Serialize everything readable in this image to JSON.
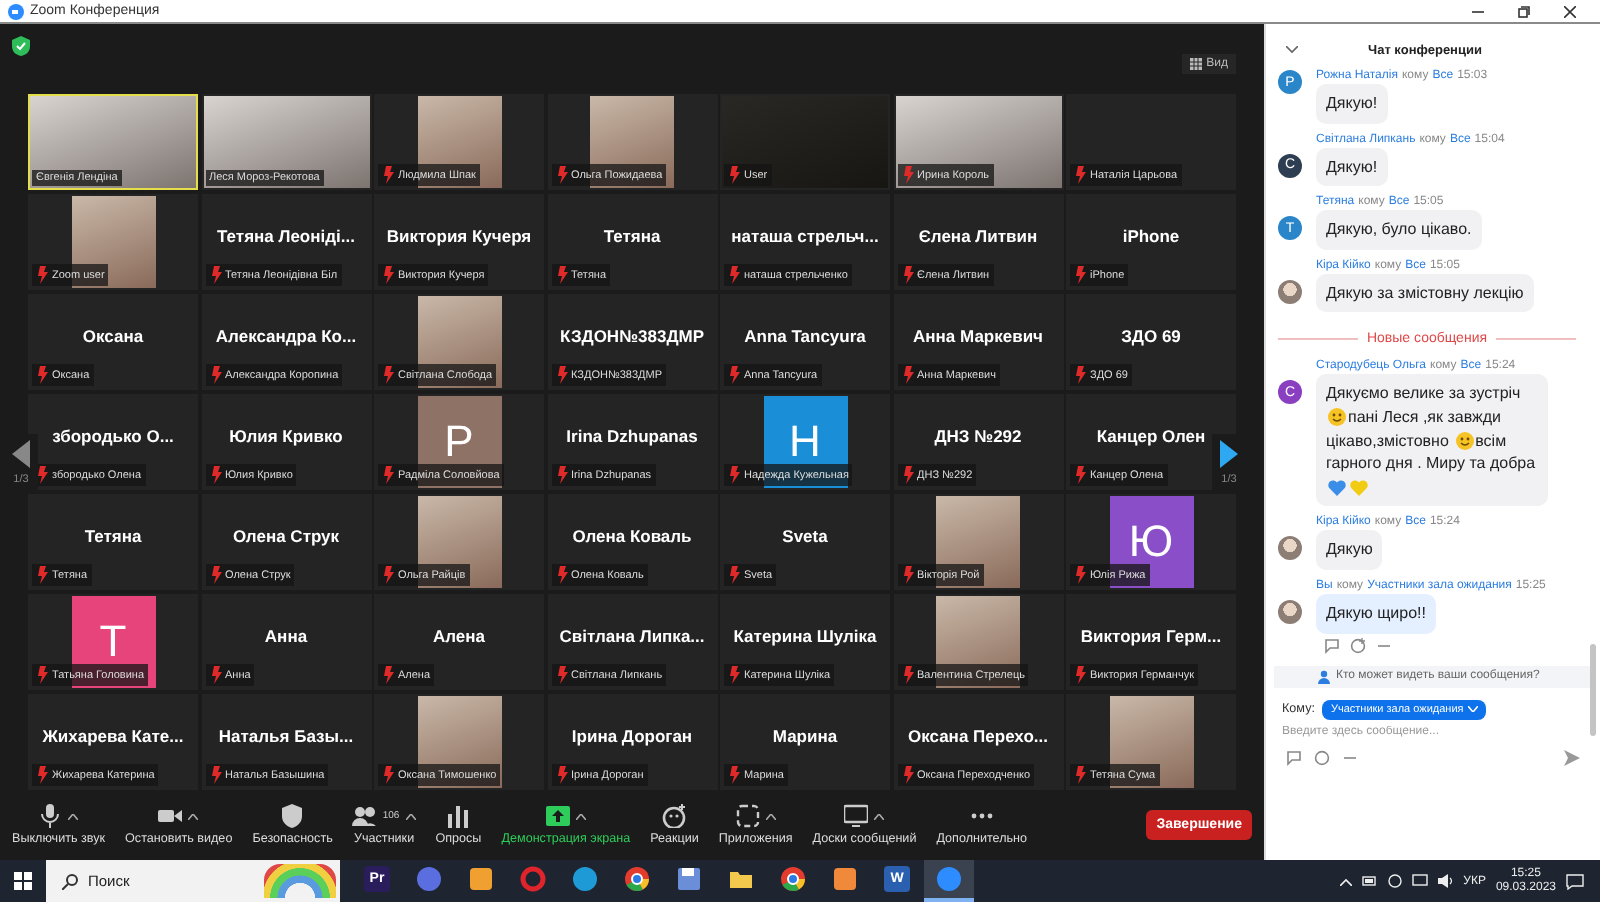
{
  "window": {
    "title": "Zoom Конференция"
  },
  "meeting": {
    "view_button": "Вид",
    "page_left": "1/3",
    "page_right": "1/3",
    "tiles": [
      {
        "kind": "video",
        "label": "Євгенія Лендіна",
        "muted": false,
        "speaking": true
      },
      {
        "kind": "video",
        "label": "Леся Мороз-Рекотова",
        "muted": false,
        "speaking": false
      },
      {
        "kind": "photo",
        "label": "Людмила Шпак",
        "muted": true,
        "speaking": false
      },
      {
        "kind": "photo",
        "label": "Ольга Пожидаева",
        "muted": true,
        "speaking": false
      },
      {
        "kind": "video",
        "label": "User",
        "muted": true,
        "speaking": false
      },
      {
        "kind": "video",
        "label": "Ирина Король",
        "muted": true,
        "speaking": false
      },
      {
        "kind": "blank",
        "label": "Наталія Царьова",
        "muted": true,
        "speaking": false
      },
      {
        "kind": "photo",
        "label": "Zoom user",
        "muted": true,
        "speaking": false
      },
      {
        "kind": "name",
        "name": "Тетяна Леонідi...",
        "label": "Тетяна Леонідівна Біл",
        "muted": true,
        "speaking": false
      },
      {
        "kind": "name",
        "name": "Виктория Кучеря",
        "label": "Виктория Кучеря",
        "muted": true,
        "speaking": false
      },
      {
        "kind": "name",
        "name": "Тетяна",
        "label": "Тетяна",
        "muted": true,
        "speaking": false
      },
      {
        "kind": "name",
        "name": "наташа стрельч...",
        "label": "наташа стрельченко",
        "muted": true,
        "speaking": false
      },
      {
        "kind": "name",
        "name": "Єлена Литвин",
        "label": "Єлена Литвин",
        "muted": true,
        "speaking": false
      },
      {
        "kind": "name",
        "name": "iPhone",
        "label": "iPhone",
        "muted": true,
        "speaking": false
      },
      {
        "kind": "name",
        "name": "Оксана",
        "label": "Оксана",
        "muted": true,
        "speaking": false
      },
      {
        "kind": "name",
        "name": "Александра Ко...",
        "label": "Александра Коропина",
        "muted": true,
        "speaking": false
      },
      {
        "kind": "photo",
        "label": "Світлана Слобода",
        "muted": true,
        "speaking": false
      },
      {
        "kind": "name",
        "name": "КЗДОН№383ДМР",
        "label": "КЗДОН№383ДМР",
        "muted": true,
        "speaking": false
      },
      {
        "kind": "name",
        "name": "Anna Tancyura",
        "label": "Anna Tancyura",
        "muted": true,
        "speaking": false
      },
      {
        "kind": "name",
        "name": "Анна Маркевич",
        "label": "Анна Маркевич",
        "muted": true,
        "speaking": false
      },
      {
        "kind": "name",
        "name": "ЗДО 69",
        "label": "ЗДО 69",
        "muted": true,
        "speaking": false
      },
      {
        "kind": "name",
        "name": "зборoдько О...",
        "label": "зборoдько Олена",
        "muted": true,
        "speaking": false
      },
      {
        "kind": "name",
        "name": "Юлия Кривко",
        "label": "Юлия Кривко",
        "muted": true,
        "speaking": false
      },
      {
        "kind": "avatar",
        "letter": "P",
        "color": "#8e7266",
        "label": "Радміла Соловйова",
        "muted": true,
        "speaking": false
      },
      {
        "kind": "name",
        "name": "Irina Dzhupanas",
        "label": "Irina Dzhupanas",
        "muted": true,
        "speaking": false
      },
      {
        "kind": "avatar",
        "letter": "H",
        "color": "#1a8fd8",
        "label": "Надежда Кужельная",
        "muted": true,
        "speaking": false
      },
      {
        "kind": "name",
        "name": "ДНЗ №292",
        "label": "ДНЗ №292",
        "muted": true,
        "speaking": false
      },
      {
        "kind": "name",
        "name": "Канцер Олен",
        "label": "Канцер Олена",
        "muted": true,
        "speaking": false
      },
      {
        "kind": "name",
        "name": "Тетяна",
        "label": "Тетяна",
        "muted": true,
        "speaking": false
      },
      {
        "kind": "name",
        "name": "Олена Струк",
        "label": "Олена Струк",
        "muted": true,
        "speaking": false
      },
      {
        "kind": "photo",
        "label": "Ольга Райців",
        "muted": true,
        "speaking": false
      },
      {
        "kind": "name",
        "name": "Олена Коваль",
        "label": "Олена Коваль",
        "muted": true,
        "speaking": false
      },
      {
        "kind": "name",
        "name": "Sveta",
        "label": "Sveta",
        "muted": true,
        "speaking": false
      },
      {
        "kind": "photo",
        "label": "Вікторія Рой",
        "muted": true,
        "speaking": false
      },
      {
        "kind": "avatar",
        "letter": "Ю",
        "color": "#8a4fc8",
        "label": "Юлія Рижа",
        "muted": true,
        "speaking": false
      },
      {
        "kind": "avatar",
        "letter": "T",
        "color": "#e6447b",
        "label": "Татьяна Головина",
        "muted": true,
        "speaking": false
      },
      {
        "kind": "name",
        "name": "Анна",
        "label": "Анна",
        "muted": true,
        "speaking": false
      },
      {
        "kind": "name",
        "name": "Алена",
        "label": "Алена",
        "muted": true,
        "speaking": false
      },
      {
        "kind": "name",
        "name": "Світлана Липка...",
        "label": "Світлана Липкань",
        "muted": true,
        "speaking": false
      },
      {
        "kind": "name",
        "name": "Катерина Шуліка",
        "label": "Катерина Шуліка",
        "muted": true,
        "speaking": false
      },
      {
        "kind": "photo",
        "label": "Валентина Стрелець",
        "muted": true,
        "speaking": false
      },
      {
        "kind": "name",
        "name": "Виктория Герм...",
        "label": "Виктория Германчук",
        "muted": true,
        "speaking": false
      },
      {
        "kind": "name",
        "name": "Жихарева Кате...",
        "label": "Жихарева Катерина",
        "muted": true,
        "speaking": false
      },
      {
        "kind": "name",
        "name": "Наталья Базы...",
        "label": "Наталья Базышина",
        "muted": true,
        "speaking": false
      },
      {
        "kind": "photo",
        "label": "Оксана Тимошенко",
        "muted": true,
        "speaking": false
      },
      {
        "kind": "name",
        "name": "Ірина Дороган",
        "label": "Ірина Дороган",
        "muted": true,
        "speaking": false
      },
      {
        "kind": "name",
        "name": "Марина",
        "label": "Марина",
        "muted": true,
        "speaking": false
      },
      {
        "kind": "name",
        "name": "Оксана Перехо...",
        "label": "Оксана Переходченко",
        "muted": true,
        "speaking": false
      },
      {
        "kind": "photo",
        "label": "Тетяна Сума",
        "muted": true,
        "speaking": false
      }
    ]
  },
  "toolbar": {
    "items": [
      {
        "kind": "mic",
        "label": "Выключить звук",
        "caret": true
      },
      {
        "kind": "video",
        "label": "Остановить видео",
        "caret": true
      },
      {
        "kind": "security",
        "label": "Безопасность",
        "caret": false
      },
      {
        "kind": "participants",
        "label": "Участники",
        "count": "106",
        "caret": true
      },
      {
        "kind": "polls",
        "label": "Опросы",
        "caret": false
      },
      {
        "kind": "share",
        "label": "Демонстрация экрана",
        "caret": true
      },
      {
        "kind": "reactions",
        "label": "Реакции",
        "caret": false
      },
      {
        "kind": "apps",
        "label": "Приложения",
        "caret": true
      },
      {
        "kind": "boards",
        "label": "Доски сообщений",
        "caret": true
      },
      {
        "kind": "more",
        "label": "Дополнительно",
        "caret": false
      }
    ],
    "end_button": "Завершение"
  },
  "chat": {
    "title": "Чат конференции",
    "messages": [
      {
        "sender": "Рожна Наталія",
        "to": "кому",
        "recipient": "Все",
        "time": "15:03",
        "avatar": {
          "kind": "letter",
          "letter": "Р",
          "color": "#2b86c9"
        },
        "own": false,
        "parts": [
          {
            "kind": "text",
            "text": "Дякую!"
          }
        ]
      },
      {
        "sender": "Світлана Липкань",
        "to": "кому",
        "recipient": "Все",
        "time": "15:04",
        "avatar": {
          "kind": "letter",
          "letter": "С",
          "color": "#2e3e52"
        },
        "own": false,
        "parts": [
          {
            "kind": "text",
            "text": "Дякую!"
          }
        ]
      },
      {
        "sender": "Тетяна",
        "to": "кому",
        "recipient": "Все",
        "time": "15:05",
        "avatar": {
          "kind": "letter",
          "letter": "Т",
          "color": "#2b86c9"
        },
        "own": false,
        "parts": [
          {
            "kind": "text",
            "text": "Дякую, було цікаво."
          }
        ]
      },
      {
        "sender": "Кіра Кійко",
        "to": "кому",
        "recipient": "Все",
        "time": "15:05",
        "avatar": {
          "kind": "photo"
        },
        "own": false,
        "parts": [
          {
            "kind": "text",
            "text": "Дякую за змістовну лекцію"
          }
        ]
      },
      {
        "kind": "divider",
        "text": "Новые сообщения"
      },
      {
        "sender": "Стародубець Ольга",
        "to": "кому",
        "recipient": "Все",
        "time": "15:24",
        "avatar": {
          "kind": "letter",
          "letter": "С",
          "color": "#8a3fc0"
        },
        "own": false,
        "parts": [
          {
            "kind": "text",
            "text": "Дякуємо велике за зустріч"
          },
          {
            "kind": "smiley"
          },
          {
            "kind": "text",
            "text": "пані Леся ,як завжди"
          },
          {
            "kind": "text",
            "text": "цікаво,змістовно"
          },
          {
            "kind": "smiley"
          },
          {
            "kind": "text",
            "text": "всім"
          },
          {
            "kind": "text",
            "text": "гарного дня . Миру та добра"
          },
          {
            "kind": "heart",
            "color": "#3b8ee8"
          },
          {
            "kind": "heart",
            "color": "#f2cc12"
          }
        ]
      },
      {
        "sender": "Кіра Кійко",
        "to": "кому",
        "recipient": "Все",
        "time": "15:24",
        "avatar": {
          "kind": "photo"
        },
        "own": false,
        "parts": [
          {
            "kind": "text",
            "text": "Дякую"
          }
        ]
      },
      {
        "sender": "Вы",
        "to": "кому",
        "recipient": "Участники зала ожидания",
        "time": "15:25",
        "avatar": {
          "kind": "photo"
        },
        "own": true,
        "parts": [
          {
            "kind": "text",
            "text": "Дякую щиро!!"
          }
        ]
      }
    ],
    "visibility_note": "Кто может видеть ваши сообщения?",
    "to_label": "Кому:",
    "to_value": "Участники зала ожидания",
    "input": {
      "placeholder": "Введите здесь сообщение..."
    }
  },
  "taskbar": {
    "search": {
      "placeholder": "Поиск"
    },
    "apps": [
      {
        "kind": "text",
        "text": "Pr",
        "color": "#2a1d5c",
        "active": false
      },
      {
        "kind": "circle",
        "color": "#5a6ee0",
        "active": false
      },
      {
        "kind": "square",
        "color": "#f0a030",
        "active": false
      },
      {
        "kind": "ring",
        "color": "#e0242b",
        "active": false
      },
      {
        "kind": "circle",
        "color": "#1e9bd6",
        "active": false
      },
      {
        "kind": "chrome",
        "active": false
      },
      {
        "kind": "floppy",
        "active": false
      },
      {
        "kind": "folder",
        "active": false
      },
      {
        "kind": "chrome",
        "active": false
      },
      {
        "kind": "square",
        "color": "#f08a3a",
        "active": false
      },
      {
        "kind": "text",
        "text": "W",
        "color": "#2b5fb0",
        "active": false
      },
      {
        "kind": "circle",
        "color": "#2d8cff",
        "active": true
      }
    ],
    "language": "УКР",
    "time": "15:25",
    "date": "09.03.2023"
  }
}
